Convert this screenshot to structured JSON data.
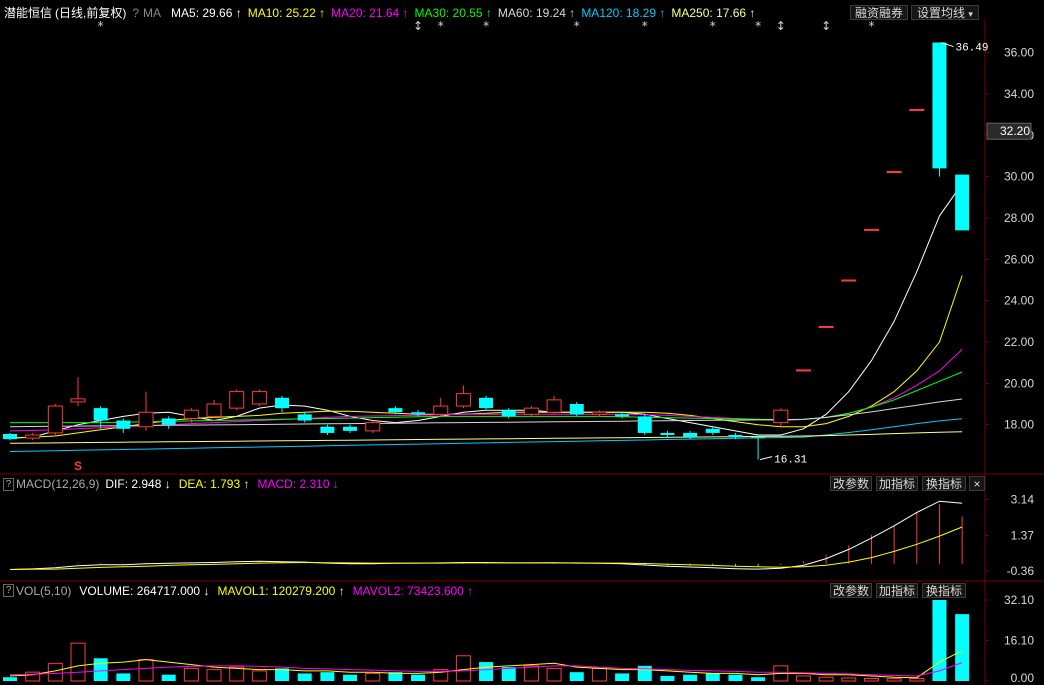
{
  "header": {
    "stock_name": "潜能恒信",
    "period_label": "(日线,前复权)",
    "ma_label": "MA",
    "ma_items": [
      {
        "label": "MA5: 29.66",
        "arrow": "↑",
        "color": "#ffffff"
      },
      {
        "label": "MA10: 25.22",
        "arrow": "↑",
        "color": "#ffff00"
      },
      {
        "label": "MA20: 21.64",
        "arrow": "↑",
        "color": "#ff00ff"
      },
      {
        "label": "MA30: 20.55",
        "arrow": "↑",
        "color": "#00ff00"
      },
      {
        "label": "MA60: 19.24",
        "arrow": "↑",
        "color": "#d8d8d8"
      },
      {
        "label": "MA120: 18.29",
        "arrow": "↑",
        "color": "#00ccff"
      },
      {
        "label": "MA250: 17.66",
        "arrow": "↑",
        "color": "#ffff88"
      }
    ],
    "margin_button": "融资融券",
    "ma_settings_button": "设置均线"
  },
  "macd_panel": {
    "title": "MACD(12,26,9)",
    "dif": "DIF: 2.948",
    "dif_arrow": "↓",
    "dea": "DEA: 1.793",
    "dea_arrow": "↑",
    "macd": "MACD: 2.310",
    "macd_arrow": "↓",
    "buttons": [
      "改参数",
      "加指标",
      "换指标"
    ],
    "close": "×"
  },
  "vol_panel": {
    "title": "VOL(5,10)",
    "volume": "VOLUME: 264717.000",
    "volume_arrow": "↓",
    "mavol1": "MAVOL1: 120279.200",
    "mavol1_arrow": "↑",
    "mavol2": "MAVOL2: 73423.600",
    "mavol2_arrow": "↑",
    "buttons": [
      "改参数",
      "加指标",
      "换指标"
    ]
  },
  "colors": {
    "up": "#ff3a3a",
    "down": "#00ffff",
    "ma5": "#ffffff",
    "ma10": "#ffff00",
    "ma20": "#ff00ff",
    "ma30": "#00ff00",
    "ma60": "#d8d8d8",
    "ma120": "#00ccff",
    "ma250": "#ffff88",
    "axis_text": "#d8d8d8"
  },
  "chart_data": [
    {
      "type": "candlestick",
      "name": "price",
      "ylim": [
        16.0,
        37.0
      ],
      "y_ticks": [
        "36.00",
        "34.00",
        "32.00",
        "30.00",
        "28.00",
        "26.00",
        "24.00",
        "22.00",
        "20.00",
        "18.00"
      ],
      "current_price_label": "32.20",
      "current_price": 32.2,
      "high_annotation": "36.49",
      "low_annotation": "16.31",
      "top_markers": [
        "*",
        "↕",
        "*",
        "*",
        "*",
        "*",
        "*",
        "*",
        "↕",
        "↕",
        "*"
      ],
      "s_marker": "S",
      "candles": [
        {
          "o": 17.55,
          "c": 17.3,
          "h": 17.6,
          "l": 17.25
        },
        {
          "o": 17.35,
          "c": 17.5,
          "h": 17.6,
          "l": 17.25
        },
        {
          "o": 17.6,
          "c": 18.9,
          "h": 19.0,
          "l": 17.5
        },
        {
          "o": 19.1,
          "c": 19.25,
          "h": 20.3,
          "l": 18.9
        },
        {
          "o": 18.8,
          "c": 18.2,
          "h": 18.9,
          "l": 17.8
        },
        {
          "o": 18.2,
          "c": 17.8,
          "h": 18.3,
          "l": 17.6
        },
        {
          "o": 17.9,
          "c": 18.6,
          "h": 19.6,
          "l": 17.7
        },
        {
          "o": 18.3,
          "c": 18.0,
          "h": 18.4,
          "l": 17.8
        },
        {
          "o": 18.3,
          "c": 18.7,
          "h": 18.8,
          "l": 18.1
        },
        {
          "o": 18.4,
          "c": 19.0,
          "h": 19.2,
          "l": 18.3
        },
        {
          "o": 18.8,
          "c": 19.6,
          "h": 19.7,
          "l": 18.7
        },
        {
          "o": 19.0,
          "c": 19.6,
          "h": 19.7,
          "l": 18.9
        },
        {
          "o": 19.3,
          "c": 18.8,
          "h": 19.4,
          "l": 18.6
        },
        {
          "o": 18.5,
          "c": 18.2,
          "h": 18.6,
          "l": 18.1
        },
        {
          "o": 17.9,
          "c": 17.6,
          "h": 18.0,
          "l": 17.5
        },
        {
          "o": 17.9,
          "c": 17.7,
          "h": 18.0,
          "l": 17.6
        },
        {
          "o": 17.7,
          "c": 18.1,
          "h": 18.2,
          "l": 17.6
        },
        {
          "o": 18.8,
          "c": 18.6,
          "h": 18.9,
          "l": 18.5
        },
        {
          "o": 18.6,
          "c": 18.5,
          "h": 18.7,
          "l": 18.4
        },
        {
          "o": 18.5,
          "c": 18.9,
          "h": 19.3,
          "l": 18.4
        },
        {
          "o": 18.9,
          "c": 19.5,
          "h": 19.9,
          "l": 18.8
        },
        {
          "o": 19.3,
          "c": 18.8,
          "h": 19.4,
          "l": 18.7
        },
        {
          "o": 18.7,
          "c": 18.4,
          "h": 18.8,
          "l": 18.3
        },
        {
          "o": 18.5,
          "c": 18.8,
          "h": 18.9,
          "l": 18.4
        },
        {
          "o": 18.6,
          "c": 19.2,
          "h": 19.4,
          "l": 18.5
        },
        {
          "o": 19.0,
          "c": 18.5,
          "h": 19.1,
          "l": 18.4
        },
        {
          "o": 18.5,
          "c": 18.6,
          "h": 18.7,
          "l": 18.4
        },
        {
          "o": 18.5,
          "c": 18.4,
          "h": 18.6,
          "l": 18.3
        },
        {
          "o": 18.4,
          "c": 17.6,
          "h": 18.5,
          "l": 17.5
        },
        {
          "o": 17.6,
          "c": 17.5,
          "h": 17.7,
          "l": 17.4
        },
        {
          "o": 17.6,
          "c": 17.4,
          "h": 17.7,
          "l": 17.3
        },
        {
          "o": 17.8,
          "c": 17.6,
          "h": 17.9,
          "l": 17.5
        },
        {
          "o": 17.5,
          "c": 17.4,
          "h": 17.6,
          "l": 17.3
        },
        {
          "o": 17.4,
          "c": 17.35,
          "h": 17.5,
          "l": 16.31
        },
        {
          "o": 18.1,
          "c": 18.7,
          "h": 18.8,
          "l": 17.9
        },
        {
          "o": 20.6,
          "c": 20.65,
          "h": 20.65,
          "l": 20.6
        },
        {
          "o": 22.7,
          "c": 22.75,
          "h": 22.75,
          "l": 22.7
        },
        {
          "o": 24.95,
          "c": 25.0,
          "h": 25.0,
          "l": 24.95
        },
        {
          "o": 27.4,
          "c": 27.45,
          "h": 27.45,
          "l": 27.4
        },
        {
          "o": 30.2,
          "c": 30.25,
          "h": 30.25,
          "l": 30.2
        },
        {
          "o": 33.2,
          "c": 33.25,
          "h": 33.25,
          "l": 33.2
        },
        {
          "o": 36.49,
          "c": 30.4,
          "h": 36.49,
          "l": 30.0
        },
        {
          "o": 30.1,
          "c": 27.4,
          "h": 30.1,
          "l": 27.4
        }
      ],
      "series": [
        {
          "name": "MA5",
          "values": [
            17.35,
            17.4,
            17.7,
            18.0,
            18.2,
            18.4,
            18.55,
            18.6,
            18.4,
            18.2,
            18.4,
            18.8,
            18.95,
            18.9,
            18.7,
            18.4,
            18.2,
            18.1,
            18.2,
            18.4,
            18.6,
            18.7,
            18.7,
            18.7,
            18.6,
            18.6,
            18.6,
            18.6,
            18.5,
            18.3,
            18.1,
            17.9,
            17.7,
            17.5,
            17.5,
            17.8,
            18.5,
            19.6,
            21.1,
            23.0,
            25.4,
            28.1,
            29.66
          ]
        },
        {
          "name": "MA10",
          "values": [
            17.35,
            17.4,
            17.45,
            17.6,
            17.75,
            17.9,
            18.05,
            18.2,
            18.3,
            18.35,
            18.4,
            18.45,
            18.55,
            18.6,
            18.65,
            18.65,
            18.6,
            18.55,
            18.5,
            18.5,
            18.5,
            18.55,
            18.6,
            18.6,
            18.6,
            18.6,
            18.6,
            18.6,
            18.6,
            18.55,
            18.45,
            18.3,
            18.15,
            18.0,
            17.9,
            17.9,
            18.05,
            18.4,
            18.9,
            19.6,
            20.6,
            22.0,
            25.22
          ]
        },
        {
          "name": "MA20",
          "values": [
            17.7,
            17.72,
            17.75,
            17.8,
            17.85,
            17.9,
            17.95,
            18.0,
            18.05,
            18.1,
            18.15,
            18.2,
            18.25,
            18.3,
            18.35,
            18.4,
            18.42,
            18.44,
            18.46,
            18.48,
            18.5,
            18.5,
            18.5,
            18.5,
            18.5,
            18.5,
            18.5,
            18.5,
            18.48,
            18.45,
            18.4,
            18.35,
            18.3,
            18.25,
            18.2,
            18.25,
            18.35,
            18.55,
            18.85,
            19.3,
            19.9,
            20.6,
            21.64
          ]
        },
        {
          "name": "MA30",
          "values": [
            18.1,
            18.1,
            18.1,
            18.1,
            18.1,
            18.12,
            18.14,
            18.16,
            18.18,
            18.2,
            18.22,
            18.24,
            18.26,
            18.28,
            18.3,
            18.32,
            18.34,
            18.36,
            18.38,
            18.4,
            18.4,
            18.4,
            18.4,
            18.4,
            18.4,
            18.4,
            18.4,
            18.38,
            18.36,
            18.34,
            18.32,
            18.3,
            18.28,
            18.26,
            18.25,
            18.25,
            18.35,
            18.55,
            18.85,
            19.2,
            19.65,
            20.1,
            20.55
          ]
        },
        {
          "name": "MA60",
          "values": [
            17.9,
            17.91,
            17.92,
            17.93,
            17.94,
            17.95,
            17.96,
            17.97,
            17.98,
            17.99,
            18.0,
            18.01,
            18.02,
            18.03,
            18.04,
            18.05,
            18.06,
            18.07,
            18.08,
            18.09,
            18.1,
            18.11,
            18.12,
            18.13,
            18.14,
            18.15,
            18.16,
            18.17,
            18.18,
            18.19,
            18.2,
            18.21,
            18.22,
            18.23,
            18.24,
            18.26,
            18.35,
            18.48,
            18.62,
            18.78,
            18.94,
            19.1,
            19.24
          ]
        },
        {
          "name": "MA120",
          "values": [
            16.7,
            16.72,
            16.74,
            16.76,
            16.78,
            16.8,
            16.82,
            16.84,
            16.86,
            16.88,
            16.9,
            16.92,
            16.94,
            16.96,
            16.98,
            17.0,
            17.02,
            17.04,
            17.06,
            17.08,
            17.1,
            17.12,
            17.14,
            17.16,
            17.18,
            17.2,
            17.22,
            17.24,
            17.26,
            17.28,
            17.3,
            17.32,
            17.34,
            17.36,
            17.38,
            17.4,
            17.5,
            17.62,
            17.75,
            17.9,
            18.05,
            18.18,
            18.29
          ]
        },
        {
          "name": "MA250",
          "values": [
            17.1,
            17.11,
            17.12,
            17.13,
            17.14,
            17.15,
            17.16,
            17.17,
            17.18,
            17.19,
            17.2,
            17.21,
            17.22,
            17.23,
            17.24,
            17.25,
            17.26,
            17.27,
            17.28,
            17.29,
            17.3,
            17.31,
            17.32,
            17.33,
            17.34,
            17.35,
            17.36,
            17.37,
            17.38,
            17.39,
            17.4,
            17.41,
            17.42,
            17.43,
            17.44,
            17.45,
            17.47,
            17.5,
            17.53,
            17.57,
            17.6,
            17.63,
            17.66
          ]
        }
      ]
    },
    {
      "type": "bar",
      "name": "MACD",
      "ylim": [
        -0.5,
        3.4
      ],
      "y_ticks": [
        "3.14",
        "1.37",
        "-0.36"
      ],
      "macd_hist": [
        0,
        0.02,
        0.03,
        0.05,
        0.04,
        0.03,
        0.04,
        0.03,
        0.02,
        0.03,
        0.05,
        0.06,
        0.04,
        0.02,
        0.0,
        -0.02,
        -0.01,
        0.02,
        0.02,
        0.03,
        0.05,
        0.04,
        0.02,
        0.02,
        0.03,
        0.01,
        0.01,
        0.0,
        -0.05,
        -0.08,
        -0.1,
        -0.1,
        -0.12,
        -0.12,
        -0.05,
        0.12,
        0.45,
        0.9,
        1.4,
        1.9,
        2.5,
        2.9,
        2.31
      ],
      "series": [
        {
          "name": "DIF",
          "values": [
            -0.28,
            -0.25,
            -0.2,
            -0.1,
            -0.05,
            -0.05,
            0.0,
            0.02,
            0.04,
            0.06,
            0.1,
            0.12,
            0.1,
            0.08,
            0.03,
            0.0,
            0.0,
            0.02,
            0.03,
            0.04,
            0.06,
            0.06,
            0.04,
            0.04,
            0.05,
            0.03,
            0.02,
            0.0,
            -0.06,
            -0.12,
            -0.16,
            -0.2,
            -0.24,
            -0.26,
            -0.22,
            -0.08,
            0.25,
            0.7,
            1.25,
            1.85,
            2.5,
            3.05,
            2.95
          ]
        },
        {
          "name": "DEA",
          "values": [
            -0.28,
            -0.27,
            -0.26,
            -0.22,
            -0.18,
            -0.15,
            -0.12,
            -0.08,
            -0.05,
            -0.03,
            0.0,
            0.03,
            0.05,
            0.06,
            0.05,
            0.04,
            0.03,
            0.03,
            0.03,
            0.03,
            0.04,
            0.04,
            0.04,
            0.04,
            0.04,
            0.04,
            0.03,
            0.03,
            0.01,
            -0.02,
            -0.05,
            -0.08,
            -0.12,
            -0.15,
            -0.17,
            -0.15,
            -0.07,
            0.08,
            0.3,
            0.6,
            0.95,
            1.35,
            1.79
          ]
        }
      ]
    },
    {
      "type": "bar",
      "name": "VOL",
      "ylim": [
        0,
        32.1
      ],
      "y_ticks": [
        "32.10",
        "16.10",
        "0.00"
      ],
      "volume": [
        1.5,
        3.5,
        7.0,
        15.0,
        9.0,
        3.0,
        8.5,
        2.5,
        5.0,
        4.5,
        5.5,
        4.0,
        5.0,
        3.0,
        3.5,
        2.5,
        3.0,
        3.5,
        2.5,
        4.5,
        10.0,
        7.5,
        5.5,
        6.0,
        5.0,
        3.5,
        5.0,
        3.0,
        6.0,
        2.0,
        2.5,
        3.0,
        2.5,
        1.5,
        6.0,
        2.0,
        1.5,
        1.2,
        1.0,
        1.0,
        1.0,
        32.1,
        26.5
      ],
      "series": [
        {
          "name": "MAVOL1",
          "values": [
            2.0,
            2.5,
            4.0,
            6.0,
            7.0,
            7.5,
            8.5,
            7.5,
            6.5,
            5.5,
            5.0,
            4.5,
            4.5,
            4.0,
            4.0,
            3.5,
            3.5,
            3.0,
            3.0,
            3.5,
            4.5,
            5.5,
            6.0,
            6.5,
            7.0,
            5.5,
            5.0,
            4.5,
            4.5,
            4.0,
            3.5,
            3.0,
            3.0,
            2.5,
            3.0,
            3.0,
            2.5,
            2.5,
            2.0,
            1.5,
            1.3,
            7.5,
            12.0
          ]
        },
        {
          "name": "MAVOL2",
          "values": [
            2.5,
            2.7,
            3.0,
            3.5,
            4.0,
            4.5,
            5.0,
            5.5,
            5.8,
            6.0,
            6.0,
            5.8,
            5.5,
            5.0,
            4.8,
            4.5,
            4.3,
            4.0,
            3.8,
            3.8,
            4.0,
            4.5,
            5.0,
            5.5,
            6.0,
            6.0,
            5.5,
            5.0,
            4.8,
            4.5,
            4.2,
            4.0,
            3.8,
            3.5,
            3.5,
            3.3,
            3.0,
            2.8,
            2.5,
            2.2,
            2.0,
            4.0,
            7.3
          ]
        }
      ]
    }
  ]
}
